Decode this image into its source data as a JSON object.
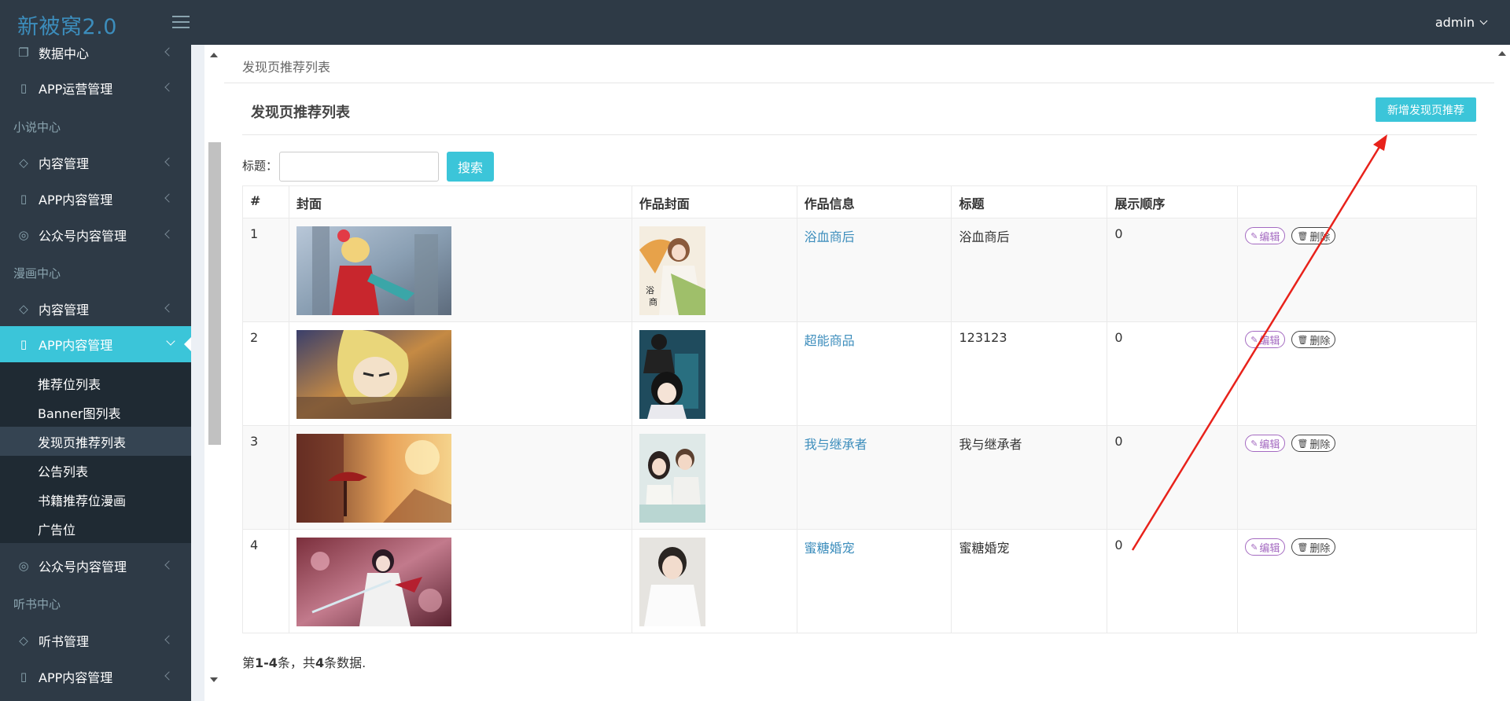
{
  "header": {
    "logo": "新被窝2.0",
    "user": "admin"
  },
  "sidebar": {
    "items": [
      {
        "label": "数据中心"
      },
      {
        "label": "APP运营管理"
      },
      {
        "label": "内容管理"
      },
      {
        "label": "APP内容管理"
      },
      {
        "label": "公众号内容管理"
      },
      {
        "label": "内容管理"
      },
      {
        "label": "APP内容管理"
      },
      {
        "label": "公众号内容管理"
      },
      {
        "label": "听书管理"
      },
      {
        "label": "APP内容管理"
      }
    ],
    "headers": [
      "小说中心",
      "漫画中心",
      "听书中心"
    ],
    "subitems": [
      "推荐位列表",
      "Banner图列表",
      "发现页推荐列表",
      "公告列表",
      "书籍推荐位漫画",
      "广告位"
    ]
  },
  "main": {
    "breadcrumb": "发现页推荐列表",
    "title": "发现页推荐列表",
    "add_button": "新增发现页推荐",
    "search": {
      "label": "标题：",
      "value": "",
      "button": "搜索"
    },
    "table": {
      "headers": [
        "#",
        "封面",
        "作品封面",
        "作品信息",
        "标题",
        "展示顺序",
        ""
      ],
      "edit_label": "编辑",
      "delete_label": "删除",
      "rows": [
        {
          "id": "1",
          "work": "浴血商后",
          "title": "浴血商后",
          "order": "0"
        },
        {
          "id": "2",
          "work": "超能商品",
          "title": "123123",
          "order": "0"
        },
        {
          "id": "3",
          "work": "我与继承者",
          "title": "我与继承者",
          "order": "0"
        },
        {
          "id": "4",
          "work": "蜜糖婚宠",
          "title": "蜜糖婚宠",
          "order": "0"
        }
      ]
    },
    "summary": {
      "prefix": "第",
      "range": "1-4",
      "middle": "条，共",
      "total": "4",
      "suffix": "条数据."
    }
  },
  "colors": {
    "accent": "#3bc5d9",
    "sidebar": "#2e3a46",
    "link": "#3c8dbc",
    "edit": "#a46ac1",
    "annotation_arrow": "#e8221b"
  }
}
